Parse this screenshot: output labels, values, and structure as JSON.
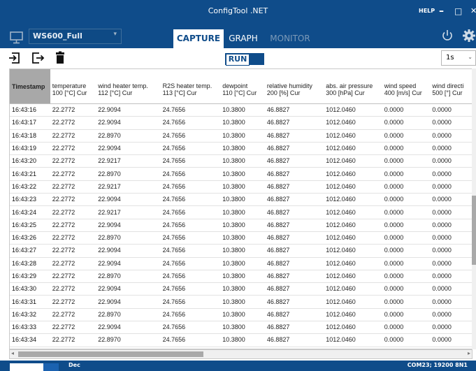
{
  "window": {
    "title": "ConfigTool .NET",
    "help_label": "HELP",
    "minimize": "–",
    "maximize": "□",
    "close": "✕"
  },
  "toolbar": {
    "device": "WS600_Full",
    "tabs": [
      {
        "label": "CAPTURE",
        "state": "active"
      },
      {
        "label": "GRAPH",
        "state": "inactive"
      },
      {
        "label": "MONITOR",
        "state": "disabled"
      }
    ]
  },
  "actions": {
    "run_label": "RUN",
    "interval": "1s"
  },
  "table": {
    "columns": [
      {
        "name": "Timestamp",
        "sub": ""
      },
      {
        "name": "temperature",
        "sub": "100 [°C] Cur"
      },
      {
        "name": "wind heater temp.",
        "sub": "112 [°C] Cur"
      },
      {
        "name": "R2S heater temp.",
        "sub": "113 [°C] Cur"
      },
      {
        "name": "dewpoint",
        "sub": "110 [°C] Cur"
      },
      {
        "name": "relative humidity",
        "sub": "200 [%] Cur"
      },
      {
        "name": "abs. air pressure",
        "sub": "300 [hPa] Cur"
      },
      {
        "name": "wind speed",
        "sub": "400 [m/s] Cur"
      },
      {
        "name": "wind directi",
        "sub": "500 [°] Cur"
      }
    ],
    "rows": [
      [
        "16:43:16",
        "22.2772",
        "22.9094",
        "24.7656",
        "10.3800",
        "46.8827",
        "1012.0460",
        "0.0000",
        "0.0000"
      ],
      [
        "16:43:17",
        "22.2772",
        "22.9094",
        "24.7656",
        "10.3800",
        "46.8827",
        "1012.0460",
        "0.0000",
        "0.0000"
      ],
      [
        "16:43:18",
        "22.2772",
        "22.8970",
        "24.7656",
        "10.3800",
        "46.8827",
        "1012.0460",
        "0.0000",
        "0.0000"
      ],
      [
        "16:43:19",
        "22.2772",
        "22.9094",
        "24.7656",
        "10.3800",
        "46.8827",
        "1012.0460",
        "0.0000",
        "0.0000"
      ],
      [
        "16:43:20",
        "22.2772",
        "22.9217",
        "24.7656",
        "10.3800",
        "46.8827",
        "1012.0460",
        "0.0000",
        "0.0000"
      ],
      [
        "16:43:21",
        "22.2772",
        "22.8970",
        "24.7656",
        "10.3800",
        "46.8827",
        "1012.0460",
        "0.0000",
        "0.0000"
      ],
      [
        "16:43:22",
        "22.2772",
        "22.9217",
        "24.7656",
        "10.3800",
        "46.8827",
        "1012.0460",
        "0.0000",
        "0.0000"
      ],
      [
        "16:43:23",
        "22.2772",
        "22.9094",
        "24.7656",
        "10.3800",
        "46.8827",
        "1012.0460",
        "0.0000",
        "0.0000"
      ],
      [
        "16:43:24",
        "22.2772",
        "22.9217",
        "24.7656",
        "10.3800",
        "46.8827",
        "1012.0460",
        "0.0000",
        "0.0000"
      ],
      [
        "16:43:25",
        "22.2772",
        "22.9094",
        "24.7656",
        "10.3800",
        "46.8827",
        "1012.0460",
        "0.0000",
        "0.0000"
      ],
      [
        "16:43:26",
        "22.2772",
        "22.8970",
        "24.7656",
        "10.3800",
        "46.8827",
        "1012.0460",
        "0.0000",
        "0.0000"
      ],
      [
        "16:43:27",
        "22.2772",
        "22.9094",
        "24.7656",
        "10.3800",
        "46.8827",
        "1012.0460",
        "0.0000",
        "0.0000"
      ],
      [
        "16:43:28",
        "22.2772",
        "22.9094",
        "24.7656",
        "10.3800",
        "46.8827",
        "1012.0460",
        "0.0000",
        "0.0000"
      ],
      [
        "16:43:29",
        "22.2772",
        "22.8970",
        "24.7656",
        "10.3800",
        "46.8827",
        "1012.0460",
        "0.0000",
        "0.0000"
      ],
      [
        "16:43:30",
        "22.2772",
        "22.9094",
        "24.7656",
        "10.3800",
        "46.8827",
        "1012.0460",
        "0.0000",
        "0.0000"
      ],
      [
        "16:43:31",
        "22.2772",
        "22.9094",
        "24.7656",
        "10.3800",
        "46.8827",
        "1012.0460",
        "0.0000",
        "0.0000"
      ],
      [
        "16:43:32",
        "22.2772",
        "22.8970",
        "24.7656",
        "10.3800",
        "46.8827",
        "1012.0460",
        "0.0000",
        "0.0000"
      ],
      [
        "16:43:33",
        "22.2772",
        "22.9094",
        "24.7656",
        "10.3800",
        "46.8827",
        "1012.0460",
        "0.0000",
        "0.0000"
      ],
      [
        "16:43:34",
        "22.2772",
        "22.8970",
        "24.7656",
        "10.3800",
        "46.8827",
        "1012.0460",
        "0.0000",
        "0.0000"
      ]
    ]
  },
  "status": {
    "base": "Dec",
    "port": "COM23; 19200 8N1"
  },
  "icons": [
    "monitor-icon",
    "power-icon",
    "settings-gear-icon",
    "import-icon",
    "export-icon",
    "trash-icon"
  ],
  "colors": {
    "accent": "#0f4c8a",
    "header_highlight": "#a8a8a8"
  }
}
